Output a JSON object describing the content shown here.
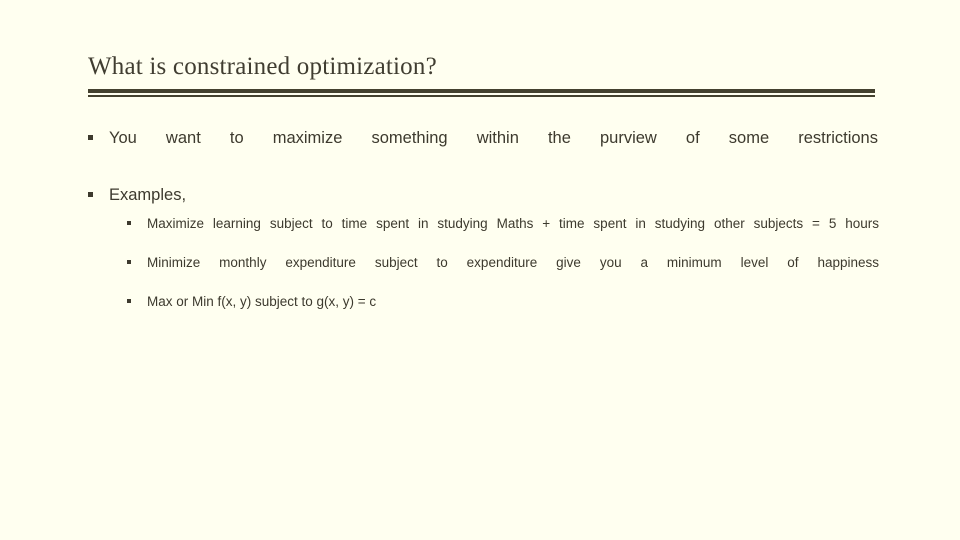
{
  "slide": {
    "background_color": "#FFFFF0",
    "text_color": "#3D3A2E",
    "rule_color": "#44412F",
    "title": "What is constrained optimization?",
    "bullet_glyph": "square-bullet",
    "bullets": [
      {
        "level": 1,
        "text": "You want to maximize something within the purview of some restrictions"
      },
      {
        "level": 1,
        "text": "Examples,",
        "children": [
          {
            "level": 2,
            "text": "Maximize learning subject to time spent in studying Maths + time spent in studying other subjects = 5 hours"
          },
          {
            "level": 2,
            "text": "Minimize monthly expenditure subject to expenditure give you a minimum level of happiness"
          },
          {
            "level": 2,
            "text": "Max or Min f(x, y) subject to g(x, y) = c"
          }
        ]
      }
    ]
  }
}
